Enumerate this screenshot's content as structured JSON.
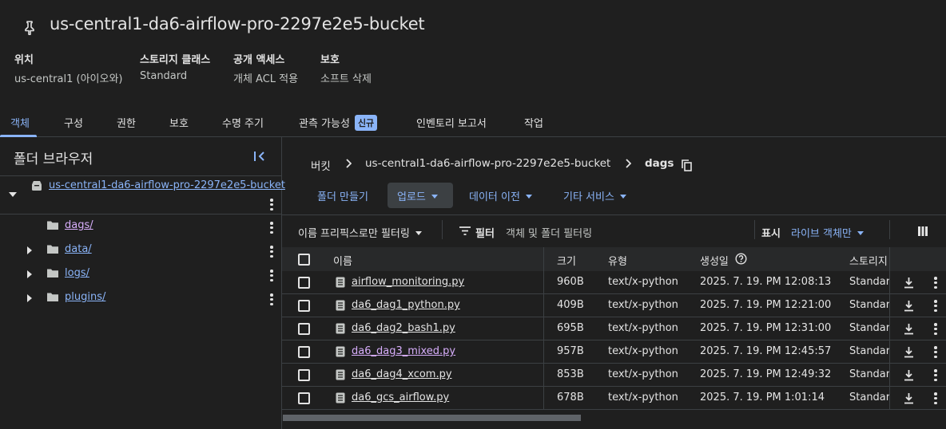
{
  "bucket": {
    "name": "us-central1-da6-airflow-pro-2297e2e5-bucket"
  },
  "meta": [
    {
      "label": "위치",
      "value": "us-central1 (아이오와)"
    },
    {
      "label": "스토리지 클래스",
      "value": "Standard"
    },
    {
      "label": "공개 액세스",
      "value": "개체 ACL 적용"
    },
    {
      "label": "보호",
      "value": "소프트 삭제"
    }
  ],
  "tabs": [
    "객체",
    "구성",
    "권한",
    "보호",
    "수명 주기",
    "관측 가능성",
    "인벤토리 보고서",
    "작업"
  ],
  "tab_badge": "신규",
  "folder_browser": {
    "title": "폴더 브라우저",
    "root": "us-central1-da6-airflow-pro-2297e2e5-bucket",
    "folders": [
      "dags/",
      "data/",
      "logs/",
      "plugins/"
    ]
  },
  "breadcrumb": {
    "root": "버킷",
    "bucket": "us-central1-da6-airflow-pro-2297e2e5-bucket",
    "current": "dags"
  },
  "actions": {
    "create_folder": "폴더 만들기",
    "upload": "업로드",
    "transfer": "데이터 이전",
    "other": "기타 서비스"
  },
  "filter": {
    "prefix": "이름 프리픽스로만 필터링",
    "label": "필터",
    "placeholder": "객체 및 폴더 필터링",
    "show_label": "표시",
    "show_value": "라이브 객체만"
  },
  "table": {
    "headers": {
      "name": "이름",
      "size": "크기",
      "type": "유형",
      "created": "생성일",
      "storage": "스토리지"
    },
    "rows": [
      {
        "name": "airflow_monitoring.py",
        "size": "960B",
        "type": "text/x-python",
        "created": "2025. 7. 19. PM 12:08:13",
        "storage": "Standard"
      },
      {
        "name": "da6_dag1_python.py",
        "size": "409B",
        "type": "text/x-python",
        "created": "2025. 7. 19. PM 12:21:00",
        "storage": "Standard"
      },
      {
        "name": "da6_dag2_bash1.py",
        "size": "695B",
        "type": "text/x-python",
        "created": "2025. 7. 19. PM 12:31:00",
        "storage": "Standard"
      },
      {
        "name": "da6_dag3_mixed.py",
        "size": "957B",
        "type": "text/x-python",
        "created": "2025. 7. 19. PM 12:45:57",
        "storage": "Standard"
      },
      {
        "name": "da6_dag4_xcom.py",
        "size": "853B",
        "type": "text/x-python",
        "created": "2025. 7. 19. PM 12:49:32",
        "storage": "Standard"
      },
      {
        "name": "da6_gcs_airflow.py",
        "size": "678B",
        "type": "text/x-python",
        "created": "2025. 7. 19. PM 1:01:14",
        "storage": "Standard"
      }
    ]
  },
  "colors": {
    "accent": "#8ab4f8",
    "visited": "#d7aefb",
    "background": "#1f1f1f"
  }
}
